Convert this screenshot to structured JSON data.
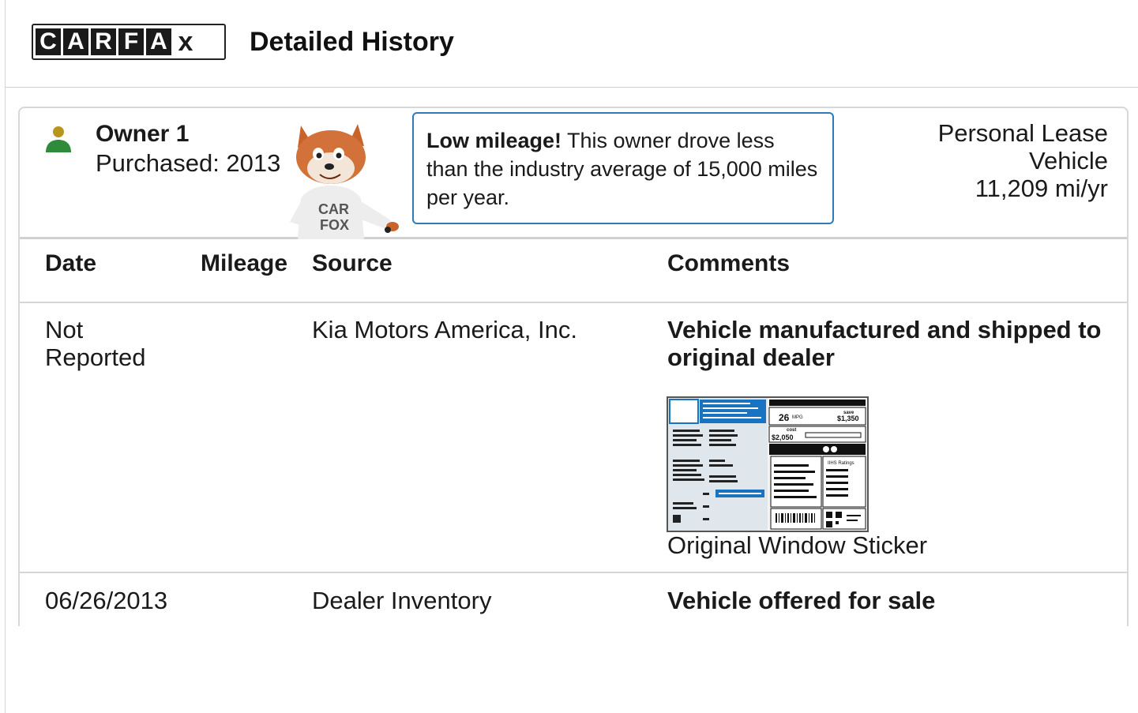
{
  "header": {
    "logo_letters": [
      "C",
      "A",
      "R",
      "F",
      "A"
    ],
    "logo_x": "x",
    "title": "Detailed History"
  },
  "owner": {
    "name": "Owner 1",
    "purchased": "Purchased: 2013",
    "icon": "person-icon",
    "icon_colors": {
      "head": "#b8961e",
      "body": "#2e8b3a"
    },
    "tip_bold": "Low mileage!",
    "tip_text": " This owner drove less than the industry average of 15,000 miles per year.",
    "type_line1": "Personal Lease",
    "type_line2": "Vehicle",
    "type_line3": "11,209 mi/yr"
  },
  "fox_shirt_text": "CAR FOX",
  "table": {
    "headers": {
      "date": "Date",
      "mileage": "Mileage",
      "source": "Source",
      "comments": "Comments"
    },
    "rows": [
      {
        "date_line1": "Not",
        "date_line2": "Reported",
        "mileage": "",
        "source": "Kia Motors America, Inc.",
        "comment": "Vehicle manufactured and shipped to original dealer",
        "sticker_caption": "Original Window Sticker"
      },
      {
        "date_line1": "06/26/2013",
        "mileage": "",
        "source": "Dealer Inventory",
        "comment": "Vehicle offered for sale"
      }
    ]
  },
  "sticker": {
    "mpg": "26",
    "mpg_unit": "MPG",
    "save_label": "save",
    "save": "$1,350",
    "cost_label": "cost",
    "cost": "$2,050",
    "iihs": "IIHS Ratings"
  },
  "colors": {
    "accent_blue": "#2f7ab9",
    "sticker_blue": "#1a73c0"
  }
}
